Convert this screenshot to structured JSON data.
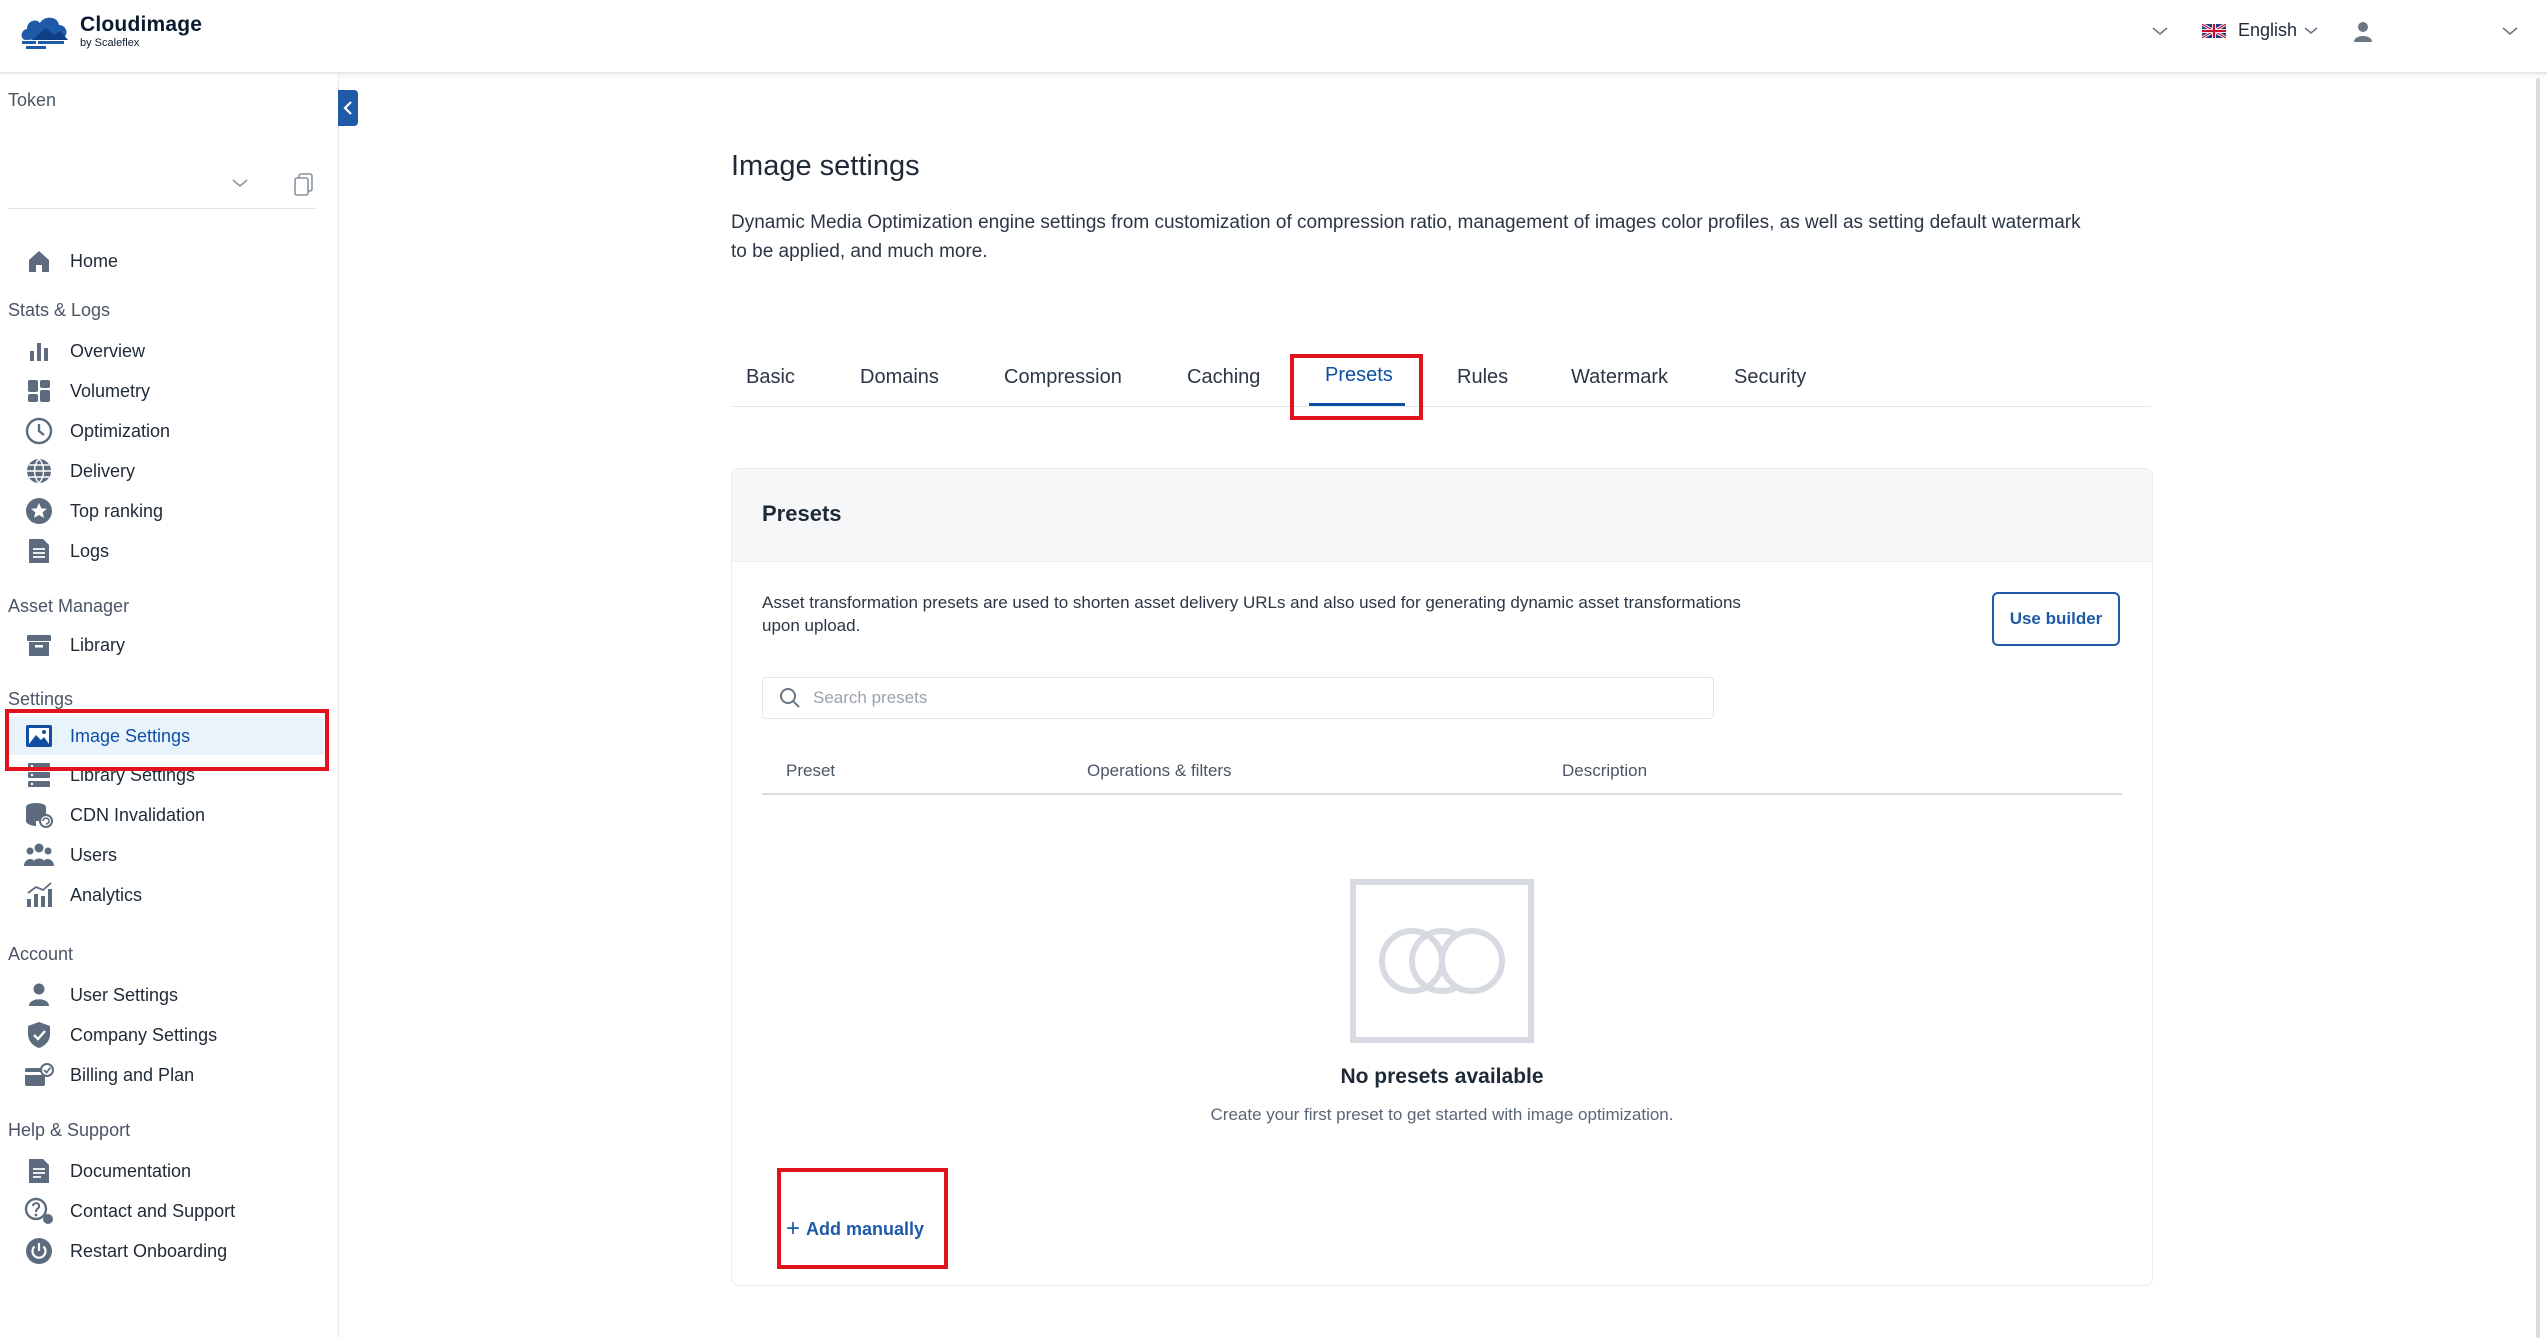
{
  "header": {
    "brand_name": "Cloudimage",
    "brand_sub": "by Scaleflex",
    "language": "English",
    "icons": [
      "cloudimage-logo",
      "chevron-down-icon",
      "uk-flag-icon",
      "user-icon"
    ]
  },
  "sidebar": {
    "token_label": "Token",
    "items": {
      "home": "Home",
      "stats_title": "Stats & Logs",
      "overview": "Overview",
      "volumetry": "Volumetry",
      "optimization": "Optimization",
      "delivery": "Delivery",
      "top_ranking": "Top ranking",
      "logs": "Logs",
      "asset_title": "Asset Manager",
      "library": "Library",
      "settings_title": "Settings",
      "image_settings": "Image Settings",
      "library_settings": "Library Settings",
      "cdn_invalidation": "CDN Invalidation",
      "users": "Users",
      "analytics": "Analytics",
      "account_title": "Account",
      "user_settings": "User Settings",
      "company_settings": "Company Settings",
      "billing": "Billing and Plan",
      "help_title": "Help & Support",
      "documentation": "Documentation",
      "contact": "Contact and Support",
      "restart": "Restart Onboarding"
    }
  },
  "main": {
    "title": "Image settings",
    "description": "Dynamic Media Optimization engine settings from customization of compression ratio, management of images color profiles, as well as setting default watermark to be applied, and much more.",
    "tabs": {
      "basic": "Basic",
      "domains": "Domains",
      "compression": "Compression",
      "caching": "Caching",
      "presets": "Presets",
      "rules": "Rules",
      "watermark": "Watermark",
      "security": "Security"
    },
    "active_tab": "Presets"
  },
  "presets_card": {
    "title": "Presets",
    "description": "Asset transformation presets are used to shorten asset delivery URLs and also used for generating dynamic asset transformations upon upload.",
    "use_builder": "Use builder",
    "search_placeholder": "Search presets",
    "columns": {
      "preset": "Preset",
      "operations": "Operations & filters",
      "description": "Description"
    },
    "empty_title": "No presets available",
    "empty_subtitle": "Create your first preset to get started with image optimization.",
    "add_manually": "Add manually"
  },
  "colors": {
    "accent": "#1e5aa8",
    "active_bg": "#e9f3fb",
    "highlight": "#e0131f",
    "icon_gray": "#5d6b7e"
  }
}
